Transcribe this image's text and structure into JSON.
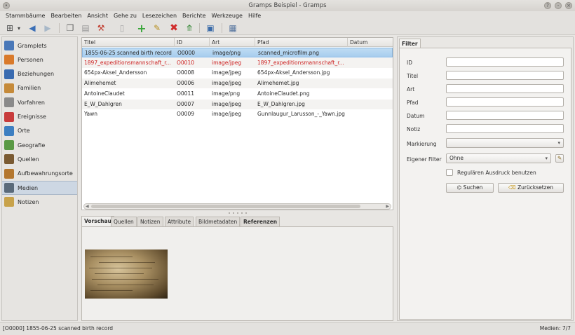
{
  "window": {
    "title": "Gramps Beispiel - Gramps"
  },
  "menubar": [
    "Stammbäume",
    "Bearbeiten",
    "Ansicht",
    "Gehe zu",
    "Lesezeichen",
    "Berichte",
    "Werkzeuge",
    "Hilfe"
  ],
  "sidebar": {
    "items": [
      {
        "label": "Gramplets",
        "icon": "gramplets-icon",
        "color": "#4a78b8"
      },
      {
        "label": "Personen",
        "icon": "person-icon",
        "color": "#d97a2b"
      },
      {
        "label": "Beziehungen",
        "icon": "relationship-icon",
        "color": "#3a6bb0"
      },
      {
        "label": "Familien",
        "icon": "family-icon",
        "color": "#c58a3a"
      },
      {
        "label": "Vorfahren",
        "icon": "pedigree-icon",
        "color": "#8a8a8a"
      },
      {
        "label": "Ereignisse",
        "icon": "calendar-icon",
        "color": "#c83c3c"
      },
      {
        "label": "Orte",
        "icon": "globe-icon",
        "color": "#3d7fc1"
      },
      {
        "label": "Geografie",
        "icon": "map-icon",
        "color": "#5a9a45"
      },
      {
        "label": "Quellen",
        "icon": "source-icon",
        "color": "#7a5a32"
      },
      {
        "label": "Aufbewahrungsorte",
        "icon": "repository-icon",
        "color": "#b4772f"
      },
      {
        "label": "Medien",
        "icon": "media-icon",
        "color": "#5a6a7a",
        "selected": true
      },
      {
        "label": "Notizen",
        "icon": "note-icon",
        "color": "#c8a24a"
      }
    ]
  },
  "media_list": {
    "columns": [
      "Titel",
      "ID",
      "Art",
      "Pfad",
      "Datum"
    ],
    "rows": [
      {
        "title": "1855-06-25 scanned birth record",
        "id": "O0000",
        "type": "image/png",
        "path": "scanned_microfilm.png",
        "date": "",
        "selected": true,
        "red": false
      },
      {
        "title": "1897_expeditionsmannschaft_r...",
        "id": "O0010",
        "type": "image/jpeg",
        "path": "1897_expeditionsmannschaft_r...",
        "date": "",
        "selected": false,
        "red": true
      },
      {
        "title": "654px-Aksel_Andersson",
        "id": "O0008",
        "type": "image/jpeg",
        "path": "654px-Aksel_Andersson.jpg",
        "date": "",
        "selected": false,
        "red": false
      },
      {
        "title": "Alimehemet",
        "id": "O0006",
        "type": "image/jpeg",
        "path": "Alimehemet.jpg",
        "date": "",
        "selected": false,
        "red": false
      },
      {
        "title": "AntoineClaudet",
        "id": "O0011",
        "type": "image/png",
        "path": "AntoineClaudet.png",
        "date": "",
        "selected": false,
        "red": false
      },
      {
        "title": "E_W_Dahlgren",
        "id": "O0007",
        "type": "image/jpeg",
        "path": "E_W_Dahlgren.jpg",
        "date": "",
        "selected": false,
        "red": false
      },
      {
        "title": "Yawn",
        "id": "O0009",
        "type": "image/jpeg",
        "path": "Gunnlaugur_Larusson_-_Yawn.jpg",
        "date": "",
        "selected": false,
        "red": false
      }
    ]
  },
  "bottom_tabs": [
    {
      "label": "Vorschau",
      "active": true
    },
    {
      "label": "Quellen",
      "active": false
    },
    {
      "label": "Notizen",
      "active": false
    },
    {
      "label": "Attribute",
      "active": false
    },
    {
      "label": "Bildmetadaten",
      "active": false
    },
    {
      "label": "Referenzen",
      "active": false
    }
  ],
  "filter": {
    "tab": "Filter",
    "fields": [
      {
        "label": "ID",
        "value": ""
      },
      {
        "label": "Titel",
        "value": ""
      },
      {
        "label": "Art",
        "value": ""
      },
      {
        "label": "Pfad",
        "value": ""
      },
      {
        "label": "Datum",
        "value": ""
      },
      {
        "label": "Notiz",
        "value": ""
      }
    ],
    "markierung_label": "Markierung",
    "markierung_value": "",
    "custom_filter_label": "Eigener Filter",
    "custom_filter_value": "Ohne",
    "regex_label": "Regulären Ausdruck benutzen",
    "search_button": "Suchen",
    "reset_button": "Zurücksetzen"
  },
  "statusbar": {
    "left": "[O0000] 1855-06-25 scanned birth record",
    "right": "Medien: 7/7"
  },
  "colors": {
    "selection": "#a7cdee",
    "private_red": "#cc1f1f"
  }
}
